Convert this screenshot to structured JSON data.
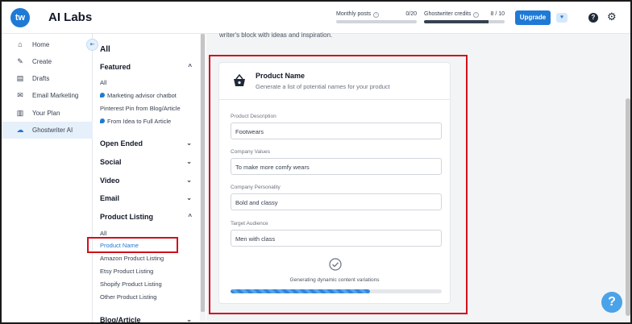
{
  "header": {
    "logo_text": "tw",
    "brand": "AI Labs",
    "monthly_posts_label": "Monthly posts",
    "monthly_posts_count": "0/20",
    "monthly_posts_fraction": 0.0,
    "credits_label": "Ghostwriter credits",
    "credits_count": "8 / 10",
    "credits_fraction": 0.8,
    "upgrade_label": "Upgrade",
    "accent": "#1f7ad6"
  },
  "nav": {
    "items": [
      {
        "label": "Home",
        "icon": "home-icon"
      },
      {
        "label": "Create",
        "icon": "pencil-icon"
      },
      {
        "label": "Drafts",
        "icon": "drafts-icon"
      },
      {
        "label": "Email Marketing",
        "icon": "mail-icon"
      },
      {
        "label": "Your Plan",
        "icon": "document-icon"
      },
      {
        "label": "Ghostwriter AI",
        "icon": "ghost-icon",
        "active": true
      }
    ]
  },
  "categories": {
    "all": "All",
    "featured": {
      "title": "Featured",
      "items": [
        "All",
        "Marketing advisor chatbot",
        "Pinterest Pin from Blog/Article",
        "From Idea to Full Article"
      ]
    },
    "open_ended": "Open Ended",
    "social": "Social",
    "video": "Video",
    "email": "Email",
    "product_listing": {
      "title": "Product Listing",
      "items": [
        "All",
        "Product Name",
        "Amazon Product Listing",
        "Etsy Product Listing",
        "Shopify Product Listing",
        "Other Product Listing"
      ]
    },
    "blog_article": "Blog/Article"
  },
  "main": {
    "intro": "writer's block with ideas and inspiration.",
    "card": {
      "title": "Product Name",
      "subtitle": "Generate a list of potential names for your product",
      "fields": [
        {
          "label": "Product Description",
          "value": "Footwears"
        },
        {
          "label": "Company Values",
          "value": "To make more comfy wears"
        },
        {
          "label": "Company Personality",
          "value": "Bold and classy"
        },
        {
          "label": "Target Audience",
          "value": "Men with class"
        }
      ],
      "status": "Generating dynamic content variations",
      "progress_fraction": 0.66
    }
  },
  "help_label": "?"
}
